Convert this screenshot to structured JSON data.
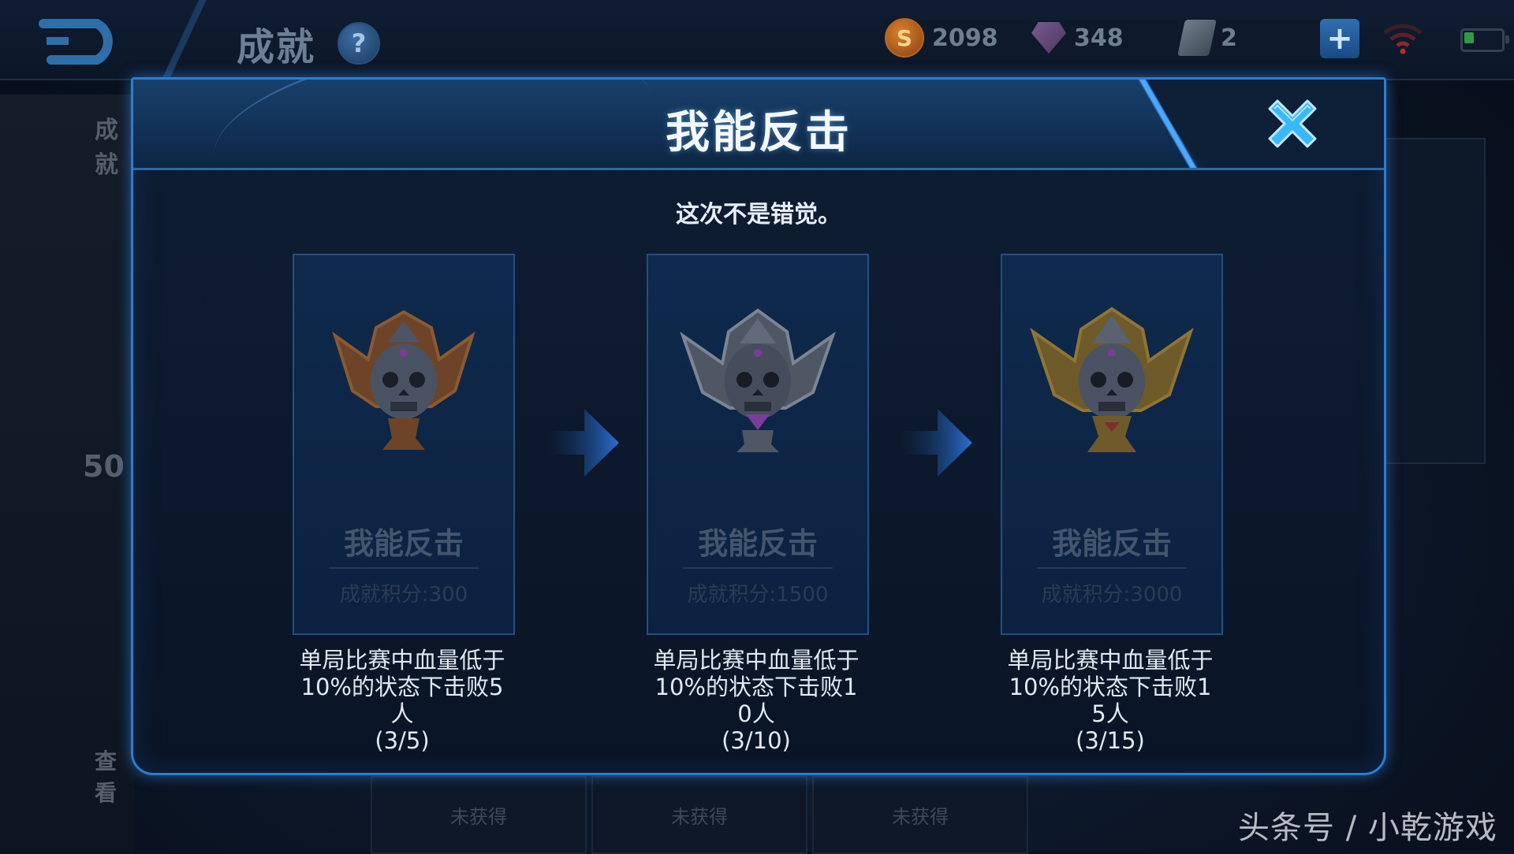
{
  "topbar": {
    "title": "成就",
    "help_label": "?",
    "gold": "2098",
    "gems": "348",
    "tickets": "2",
    "plus_label": "+"
  },
  "background": {
    "side_label_1": "成就",
    "side_label_2": "50",
    "side_label_3": "查看",
    "tab_1": "未获得",
    "tab_2": "未获得",
    "tab_3": "未获得"
  },
  "modal": {
    "title": "我能反击",
    "subtitle": "这次不是错觉。",
    "tiers": [
      {
        "tier": "bronze",
        "name": "我能反击",
        "points": "成就积分:300",
        "desc_lines": [
          "单局比赛中血量低于",
          "10%的状态下击败5",
          "人"
        ],
        "progress": "(3/5)"
      },
      {
        "tier": "silver",
        "name": "我能反击",
        "points": "成就积分:1500",
        "desc_lines": [
          "单局比赛中血量低于",
          "10%的状态下击败1",
          "0人"
        ],
        "progress": "(3/10)"
      },
      {
        "tier": "gold",
        "name": "我能反击",
        "points": "成就积分:3000",
        "desc_lines": [
          "单局比赛中血量低于",
          "10%的状态下击败1",
          "5人"
        ],
        "progress": "(3/15)"
      }
    ]
  },
  "colors": {
    "accent": "#2c7ed1",
    "bronze": "#8a5a33",
    "silver": "#7c8594",
    "gold": "#8f7535"
  },
  "watermark": "头条号 / 小乾游戏"
}
